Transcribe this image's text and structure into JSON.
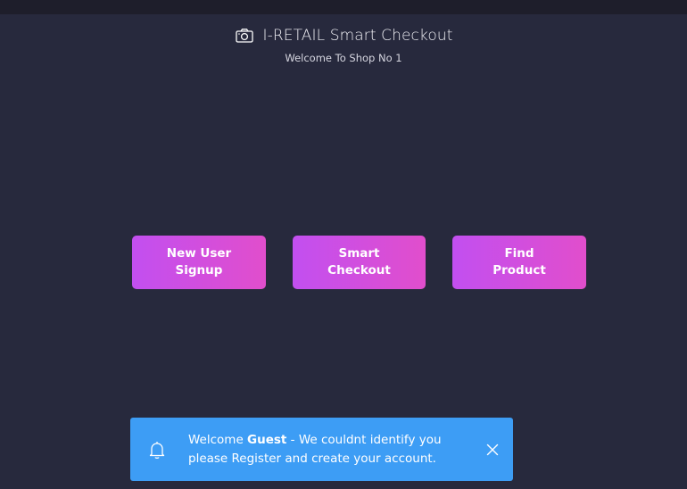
{
  "header": {
    "title": "I-RETAIL Smart Checkout",
    "subtitle": "Welcome To Shop No 1",
    "icon": "camera-icon"
  },
  "actions": [
    {
      "line1": "New User",
      "line2": "Signup"
    },
    {
      "line1": "Smart",
      "line2": "Checkout"
    },
    {
      "line1": "Find",
      "line2": "Product"
    }
  ],
  "notification": {
    "prefix": "Welcome ",
    "user": "Guest",
    "message": " - We couldnt identify you please Register and create your account.",
    "icon": "bell-icon",
    "close_icon": "close-icon"
  },
  "colors": {
    "background": "#27293d",
    "button_gradient_start": "#c24ff0",
    "button_gradient_end": "#e14ecc",
    "notification_bg": "#3d9df5"
  }
}
